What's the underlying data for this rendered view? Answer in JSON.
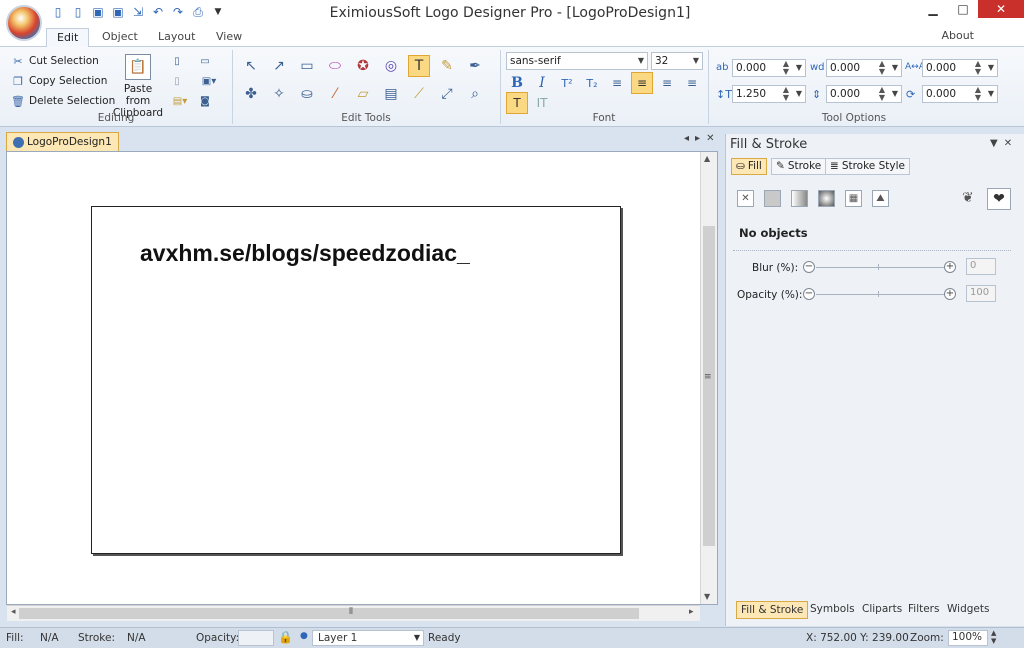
{
  "app": {
    "title": "EximiousSoft Logo Designer Pro - [LogoProDesign1]"
  },
  "qat_icons": [
    "new-icon",
    "open-icon",
    "save-icon",
    "save-as-icon",
    "export-icon",
    "undo-icon",
    "redo-icon",
    "print-icon",
    "customize-icon"
  ],
  "tabs": [
    {
      "label": "Edit",
      "active": true
    },
    {
      "label": "Object"
    },
    {
      "label": "Layout"
    },
    {
      "label": "View"
    }
  ],
  "about": "About",
  "ribbon": {
    "editing": {
      "cut": "Cut Selection",
      "copy": "Copy Selection",
      "delete": "Delete Selection",
      "paste_line1": "Paste from",
      "paste_line2": "Clipboard",
      "label": "Editing"
    },
    "edit_tools": {
      "label": "Edit Tools"
    },
    "font": {
      "family": "sans-serif",
      "size": "32",
      "label": "Font"
    },
    "tool_options": {
      "label": "Tool Options",
      "v1": "0.000",
      "v2": "0.000",
      "v3": "0.000",
      "v4": "1.250",
      "v5": "0.000",
      "v6": "0.000"
    }
  },
  "document": {
    "tab": "LogoProDesign1",
    "text": "avxhm.se/blogs/speedzodiac_"
  },
  "panel": {
    "title": "Fill & Stroke",
    "tabs": [
      "Fill",
      "Stroke",
      "Stroke Style"
    ],
    "no_objects": "No objects",
    "blur_label": "Blur (%):",
    "blur_value": "0",
    "opacity_label": "Opacity (%):",
    "opacity_value": "100",
    "bottom_tabs": [
      "Fill & Stroke",
      "Symbols",
      "Cliparts",
      "Filters",
      "Widgets"
    ]
  },
  "status": {
    "fill_label": "Fill:",
    "fill_value": "N/A",
    "stroke_label": "Stroke:",
    "stroke_value": "N/A",
    "opacity_label": "Opacity:",
    "layer": "Layer 1",
    "ready": "Ready",
    "coords": "X: 752.00 Y: 239.00",
    "zoom_label": "Zoom:",
    "zoom_value": "100%"
  }
}
